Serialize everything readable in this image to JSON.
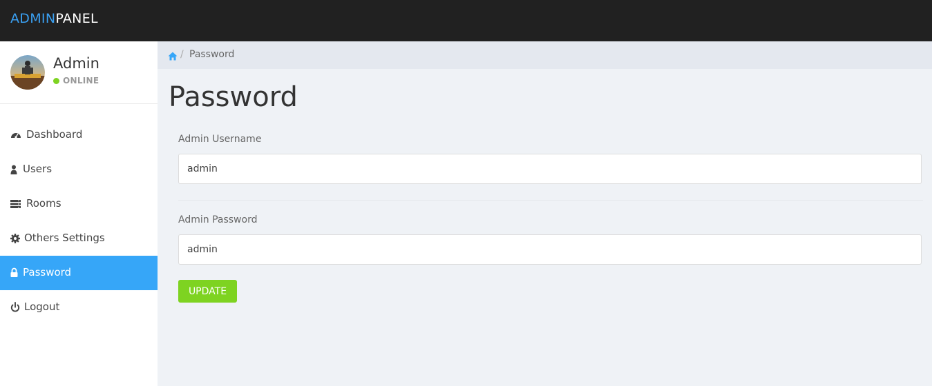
{
  "brand": {
    "part1": "ADMIN",
    "part2": "PANEL"
  },
  "profile": {
    "name": "Admin",
    "status": "ONLINE"
  },
  "nav": [
    {
      "label": "Dashboard",
      "icon": "dashboard-icon"
    },
    {
      "label": "Users",
      "icon": "user-icon"
    },
    {
      "label": "Rooms",
      "icon": "server-icon"
    },
    {
      "label": "Others Settings",
      "icon": "gear-icon"
    },
    {
      "label": "Password",
      "icon": "lock-icon",
      "active": true
    },
    {
      "label": "Logout",
      "icon": "power-icon"
    }
  ],
  "breadcrumb": {
    "separator": "/",
    "current": "Password"
  },
  "page": {
    "title": "Password"
  },
  "form": {
    "username_label": "Admin Username",
    "username_value": "admin",
    "password_label": "Admin Password",
    "password_value": "admin",
    "submit_label": "UPDATE"
  },
  "colors": {
    "accent": "#36a6f8",
    "success": "#7ed321",
    "topbar": "#212121"
  }
}
